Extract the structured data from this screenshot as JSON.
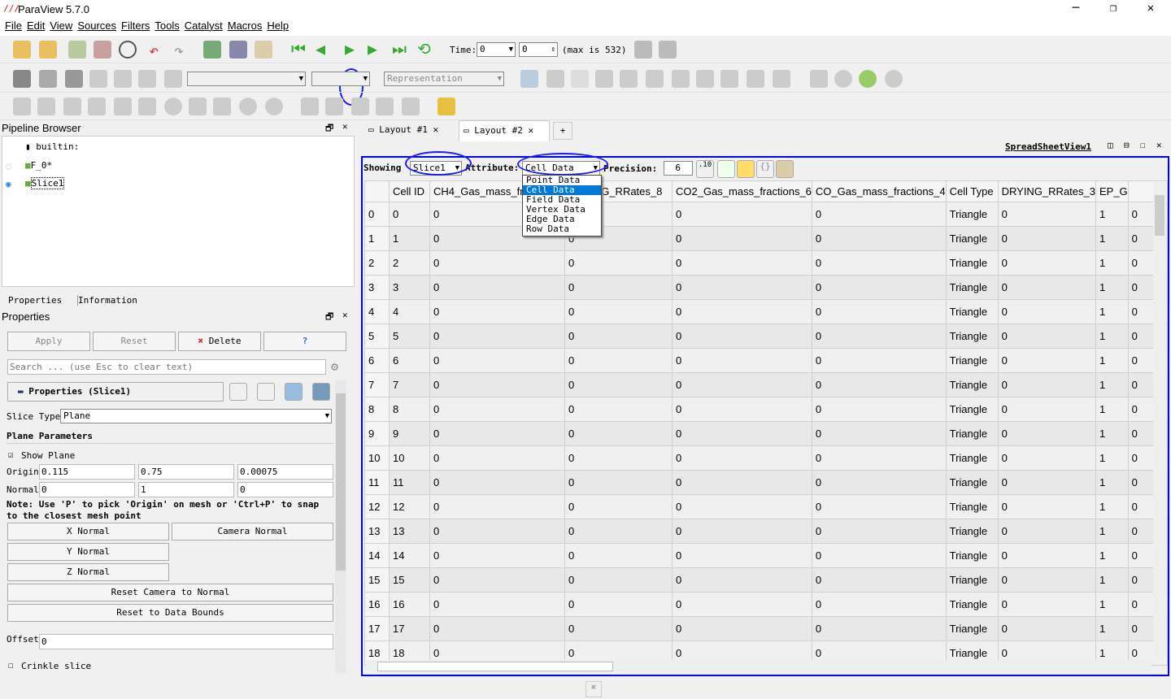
{
  "window": {
    "title": "ParaView 5.7.0",
    "minimize": "─",
    "maximize": "❐",
    "close": "✕"
  },
  "menu": [
    "File",
    "Edit",
    "View",
    "Sources",
    "Filters",
    "Tools",
    "Catalyst",
    "Macros",
    "Help"
  ],
  "time": {
    "label": "Time:",
    "value": "0",
    "index": "0",
    "max_label": "(max is 532)"
  },
  "toolbar2": {
    "representation_placeholder": "Representation"
  },
  "pipeline": {
    "title": "Pipeline Browser",
    "items": [
      {
        "label": "builtin:"
      },
      {
        "label": "F_0*",
        "visible": false
      },
      {
        "label": "Slice1",
        "visible": true,
        "selected": true
      }
    ]
  },
  "props_tabs": [
    "Properties",
    "Information"
  ],
  "properties": {
    "title": "Properties",
    "apply": "Apply",
    "reset": "Reset",
    "delete": "Delete",
    "help": "?",
    "search_placeholder": "Search ... (use Esc to clear text)",
    "section": "Properties (Slice1)",
    "slice_type_label": "Slice Type",
    "slice_type": "Plane",
    "plane_params": "Plane Parameters",
    "show_plane": "Show Plane",
    "show_plane_checked": true,
    "origin_label": "Origin",
    "origin": [
      "0.115",
      "0.75",
      "0.00075"
    ],
    "normal_label": "Normal",
    "normal": [
      "0",
      "1",
      "0"
    ],
    "note": "Note: Use 'P' to pick 'Origin' on mesh or 'Ctrl+P' to snap to the closest mesh point",
    "x_normal": "X Normal",
    "y_normal": "Y Normal",
    "z_normal": "Z Normal",
    "camera_normal": "Camera Normal",
    "reset_camera": "Reset Camera to Normal",
    "reset_bounds": "Reset to Data Bounds",
    "offset_label": "Offset",
    "offset": "0",
    "crinkle": "Crinkle slice",
    "crinkle_checked": false
  },
  "layout_tabs": [
    {
      "label": "Layout #1"
    },
    {
      "label": "Layout #2"
    },
    {
      "label": "+"
    }
  ],
  "view_name": "SpreadSheetView1",
  "spreadsheet": {
    "showing_label": "Showing",
    "showing": "Slice1",
    "attribute_label": "Attribute:",
    "attribute": "Cell Data",
    "precision_label": "Precision:",
    "precision": "6",
    "attribute_options": [
      "Point Data",
      "Cell Data",
      "Field Data",
      "Vertex Data",
      "Edge Data",
      "Row Data"
    ],
    "columns": [
      "",
      "Cell ID",
      "CH4_Gas_mass_fractions",
      "DRYING_RRates_8",
      "CO2_Gas_mass_fractions_6",
      "CO_Gas_mass_fractions_4",
      "Cell Type",
      "DRYING_RRates_3",
      "EP_G",
      ""
    ],
    "rows": [
      [
        "0",
        "0",
        "0",
        "0",
        "0",
        "0",
        "Triangle",
        "0",
        "1",
        "0"
      ],
      [
        "1",
        "1",
        "0",
        "0",
        "0",
        "0",
        "Triangle",
        "0",
        "1",
        "0"
      ],
      [
        "2",
        "2",
        "0",
        "0",
        "0",
        "0",
        "Triangle",
        "0",
        "1",
        "0"
      ],
      [
        "3",
        "3",
        "0",
        "0",
        "0",
        "0",
        "Triangle",
        "0",
        "1",
        "0"
      ],
      [
        "4",
        "4",
        "0",
        "0",
        "0",
        "0",
        "Triangle",
        "0",
        "1",
        "0"
      ],
      [
        "5",
        "5",
        "0",
        "0",
        "0",
        "0",
        "Triangle",
        "0",
        "1",
        "0"
      ],
      [
        "6",
        "6",
        "0",
        "0",
        "0",
        "0",
        "Triangle",
        "0",
        "1",
        "0"
      ],
      [
        "7",
        "7",
        "0",
        "0",
        "0",
        "0",
        "Triangle",
        "0",
        "1",
        "0"
      ],
      [
        "8",
        "8",
        "0",
        "0",
        "0",
        "0",
        "Triangle",
        "0",
        "1",
        "0"
      ],
      [
        "9",
        "9",
        "0",
        "0",
        "0",
        "0",
        "Triangle",
        "0",
        "1",
        "0"
      ],
      [
        "10",
        "10",
        "0",
        "0",
        "0",
        "0",
        "Triangle",
        "0",
        "1",
        "0"
      ],
      [
        "11",
        "11",
        "0",
        "0",
        "0",
        "0",
        "Triangle",
        "0",
        "1",
        "0"
      ],
      [
        "12",
        "12",
        "0",
        "0",
        "0",
        "0",
        "Triangle",
        "0",
        "1",
        "0"
      ],
      [
        "13",
        "13",
        "0",
        "0",
        "0",
        "0",
        "Triangle",
        "0",
        "1",
        "0"
      ],
      [
        "14",
        "14",
        "0",
        "0",
        "0",
        "0",
        "Triangle",
        "0",
        "1",
        "0"
      ],
      [
        "15",
        "15",
        "0",
        "0",
        "0",
        "0",
        "Triangle",
        "0",
        "1",
        "0"
      ],
      [
        "16",
        "16",
        "0",
        "0",
        "0",
        "0",
        "Triangle",
        "0",
        "1",
        "0"
      ],
      [
        "17",
        "17",
        "0",
        "0",
        "0",
        "0",
        "Triangle",
        "0",
        "1",
        "0"
      ],
      [
        "18",
        "18",
        "0",
        "0",
        "0",
        "0",
        "Triangle",
        "0",
        "1",
        "0"
      ]
    ]
  },
  "colors": {
    "accent": "#0000ff",
    "selection": "#0078d7",
    "annotation": "#1a1aff"
  }
}
